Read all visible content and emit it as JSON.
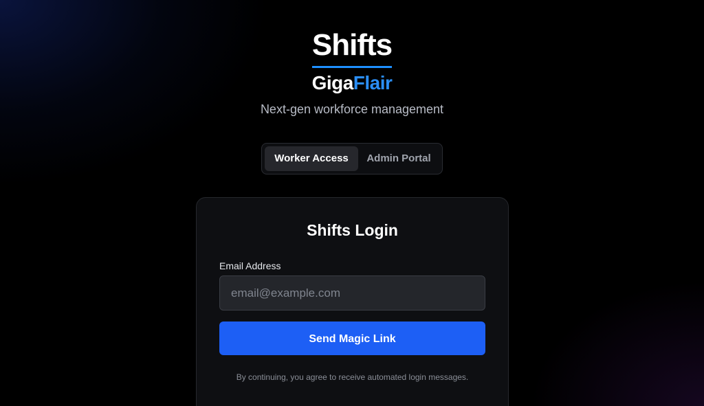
{
  "brand": {
    "logo_title": "Shifts",
    "logo_sub_primary": "Giga",
    "logo_sub_accent": "Flair",
    "tagline": "Next-gen workforce management",
    "accent_color": "#2b8ef5"
  },
  "access_toggle": {
    "options": [
      {
        "label": "Worker Access",
        "selected": true
      },
      {
        "label": "Admin Portal",
        "selected": false
      }
    ]
  },
  "login_card": {
    "title": "Shifts Login",
    "email_label": "Email Address",
    "email_value": "",
    "email_placeholder": "email@example.com",
    "submit_label": "Send Magic Link",
    "submit_color": "#1d5ff5",
    "footnote": "By continuing, you agree to receive automated login messages."
  }
}
